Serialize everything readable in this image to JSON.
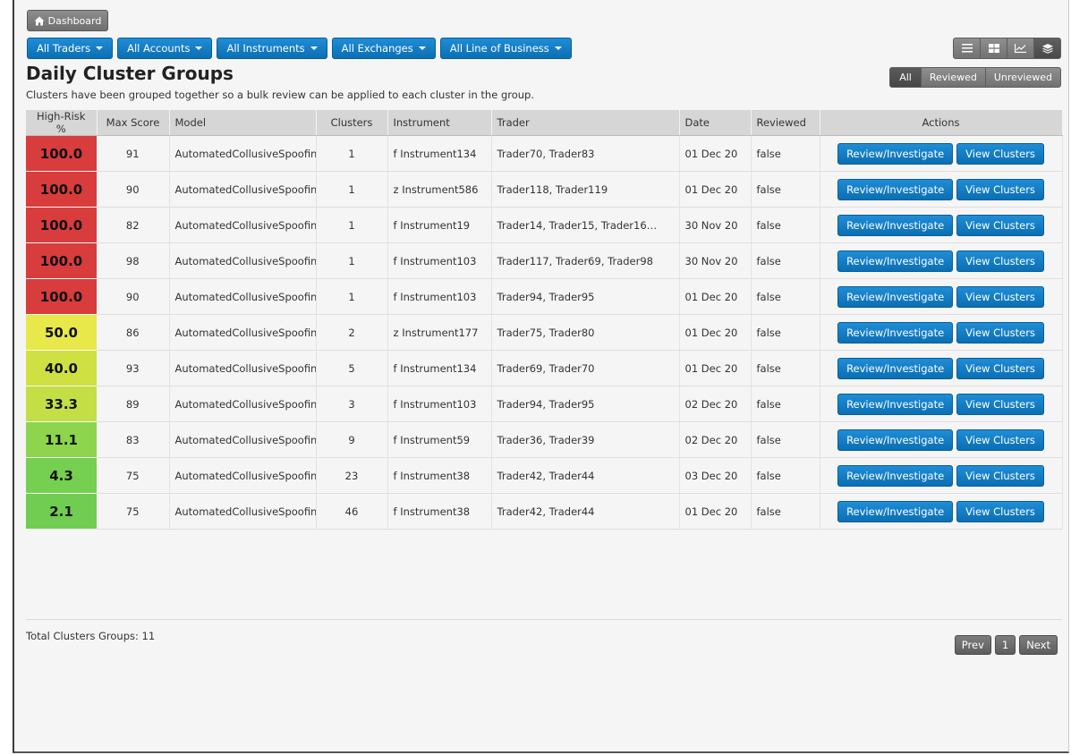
{
  "nav": {
    "dashboard_label": "Dashboard"
  },
  "filters": [
    {
      "label": "All Traders"
    },
    {
      "label": "All Accounts"
    },
    {
      "label": "All Instruments"
    },
    {
      "label": "All Exchanges"
    },
    {
      "label": "All Line of Business"
    }
  ],
  "view_modes": [
    "list-view-icon",
    "grid-view-icon",
    "chart-view-icon",
    "layers-view-icon"
  ],
  "page": {
    "title": "Daily Cluster Groups",
    "subtitle": "Clusters have been grouped together so a bulk review can be applied to each cluster in the group."
  },
  "review_filter": {
    "options": [
      "All",
      "Reviewed",
      "Unreviewed"
    ],
    "selected": "All"
  },
  "table": {
    "columns": [
      "High-Risk %",
      "Max Score",
      "Model",
      "Clusters",
      "Instrument",
      "Trader",
      "Date",
      "Reviewed",
      "Actions"
    ],
    "rows": [
      {
        "risk": "100.0",
        "risk_color": "#d83c3c",
        "max_score": "91",
        "model": "AutomatedCollusiveSpoofing",
        "clusters": "1",
        "instrument": "f Instrument134",
        "trader": "Trader70, Trader83",
        "date": "01 Dec 20",
        "reviewed": "false"
      },
      {
        "risk": "100.0",
        "risk_color": "#d83c3c",
        "max_score": "90",
        "model": "AutomatedCollusiveSpoofing",
        "clusters": "1",
        "instrument": "z Instrument586",
        "trader": "Trader118, Trader119",
        "date": "01 Dec 20",
        "reviewed": "false"
      },
      {
        "risk": "100.0",
        "risk_color": "#d83c3c",
        "max_score": "82",
        "model": "AutomatedCollusiveSpoofing",
        "clusters": "1",
        "instrument": "f Instrument19",
        "trader": "Trader14, Trader15, Trader16…",
        "date": "30 Nov 20",
        "reviewed": "false"
      },
      {
        "risk": "100.0",
        "risk_color": "#d83c3c",
        "max_score": "98",
        "model": "AutomatedCollusiveSpoofing",
        "clusters": "1",
        "instrument": "f Instrument103",
        "trader": "Trader117, Trader69, Trader98",
        "date": "30 Nov 20",
        "reviewed": "false"
      },
      {
        "risk": "100.0",
        "risk_color": "#d83c3c",
        "max_score": "90",
        "model": "AutomatedCollusiveSpoofing",
        "clusters": "1",
        "instrument": "f Instrument103",
        "trader": "Trader94, Trader95",
        "date": "01 Dec 20",
        "reviewed": "false"
      },
      {
        "risk": "50.0",
        "risk_color": "#e8e84a",
        "max_score": "86",
        "model": "AutomatedCollusiveSpoofing",
        "clusters": "2",
        "instrument": "z Instrument177",
        "trader": "Trader75, Trader80",
        "date": "01 Dec 20",
        "reviewed": "false"
      },
      {
        "risk": "40.0",
        "risk_color": "#cfe043",
        "max_score": "93",
        "model": "AutomatedCollusiveSpoofing",
        "clusters": "5",
        "instrument": "f Instrument134",
        "trader": "Trader69, Trader70",
        "date": "01 Dec 20",
        "reviewed": "false"
      },
      {
        "risk": "33.3",
        "risk_color": "#c4df45",
        "max_score": "89",
        "model": "AutomatedCollusiveSpoofing",
        "clusters": "3",
        "instrument": "f Instrument103",
        "trader": "Trader94, Trader95",
        "date": "02 Dec 20",
        "reviewed": "false"
      },
      {
        "risk": "11.1",
        "risk_color": "#8dd54c",
        "max_score": "83",
        "model": "AutomatedCollusiveSpoofing",
        "clusters": "9",
        "instrument": "f Instrument59",
        "trader": "Trader36, Trader39",
        "date": "02 Dec 20",
        "reviewed": "false"
      },
      {
        "risk": "4.3",
        "risk_color": "#75cf50",
        "max_score": "75",
        "model": "AutomatedCollusiveSpoofing",
        "clusters": "23",
        "instrument": "f Instrument38",
        "trader": "Trader42, Trader44",
        "date": "03 Dec 20",
        "reviewed": "false"
      },
      {
        "risk": "2.1",
        "risk_color": "#70cd52",
        "max_score": "75",
        "model": "AutomatedCollusiveSpoofing",
        "clusters": "46",
        "instrument": "f Instrument38",
        "trader": "Trader42, Trader44",
        "date": "01 Dec 20",
        "reviewed": "false"
      }
    ],
    "actions": {
      "review_label": "Review/Investigate",
      "view_label": "View Clusters"
    }
  },
  "footer": {
    "total_label": "Total Clusters Groups: 11",
    "pagination": {
      "prev": "Prev",
      "current": "1",
      "next": "Next"
    }
  }
}
